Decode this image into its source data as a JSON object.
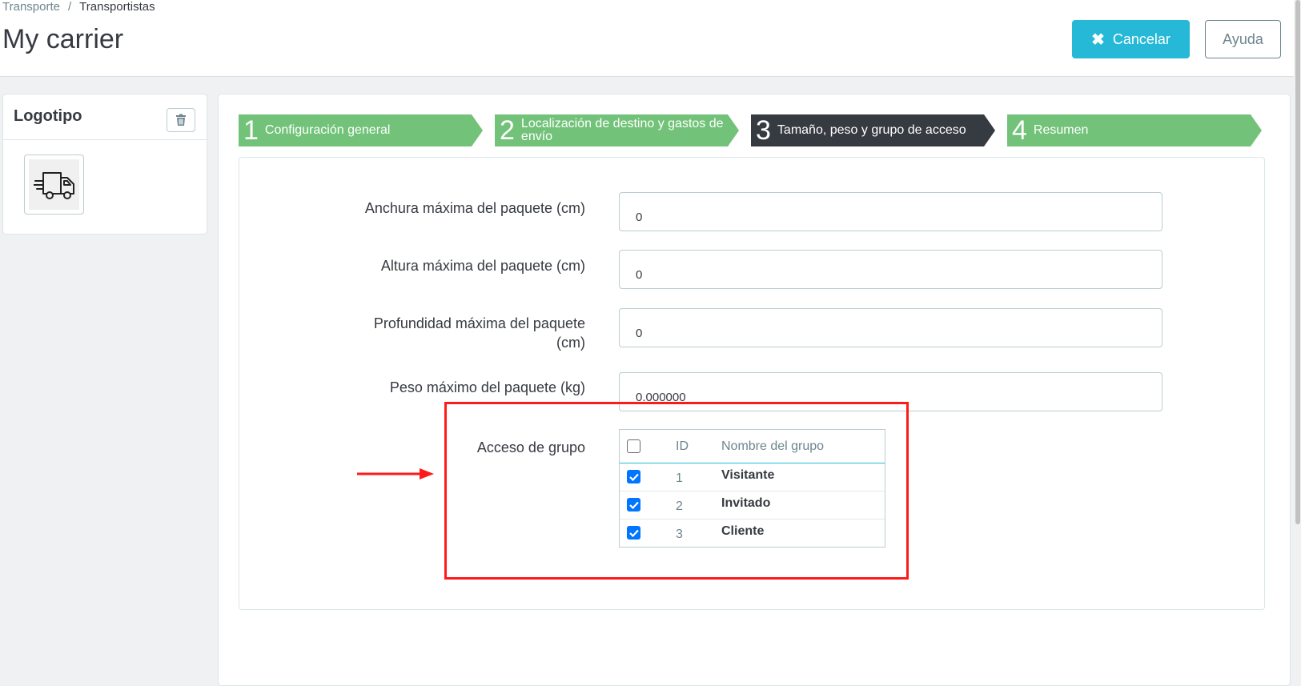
{
  "breadcrumb": {
    "parent": "Transporte",
    "separator": "/",
    "current": "Transportistas"
  },
  "page_title": "My carrier",
  "toolbar": {
    "cancel_label": "Cancelar",
    "help_label": "Ayuda"
  },
  "logo_panel": {
    "title": "Logotipo"
  },
  "steps": [
    {
      "num": "1",
      "label": "Configuración general"
    },
    {
      "num": "2",
      "label": "Localización de destino y gastos de envío"
    },
    {
      "num": "3",
      "label": "Tamaño, peso y grupo de acceso"
    },
    {
      "num": "4",
      "label": "Resumen"
    }
  ],
  "form": {
    "width_label": "Anchura máxima del paquete (cm)",
    "width_value": "0",
    "height_label": "Altura máxima del paquete (cm)",
    "height_value": "0",
    "depth_label": "Profundidad máxima del paquete (cm)",
    "depth_value": "0",
    "weight_label": "Peso máximo del paquete (kg)",
    "weight_value": "0.000000",
    "group_label": "Acceso de grupo"
  },
  "group_table": {
    "headers": {
      "id": "ID",
      "name": "Nombre del grupo"
    },
    "rows": [
      {
        "id": "1",
        "name": "Visitante",
        "checked": true
      },
      {
        "id": "2",
        "name": "Invitado",
        "checked": true
      },
      {
        "id": "3",
        "name": "Cliente",
        "checked": true
      }
    ]
  },
  "colors": {
    "accent": "#25b9d7",
    "step_done": "#72c279",
    "step_active": "#363a41",
    "annotation": "#ff1a1a"
  }
}
